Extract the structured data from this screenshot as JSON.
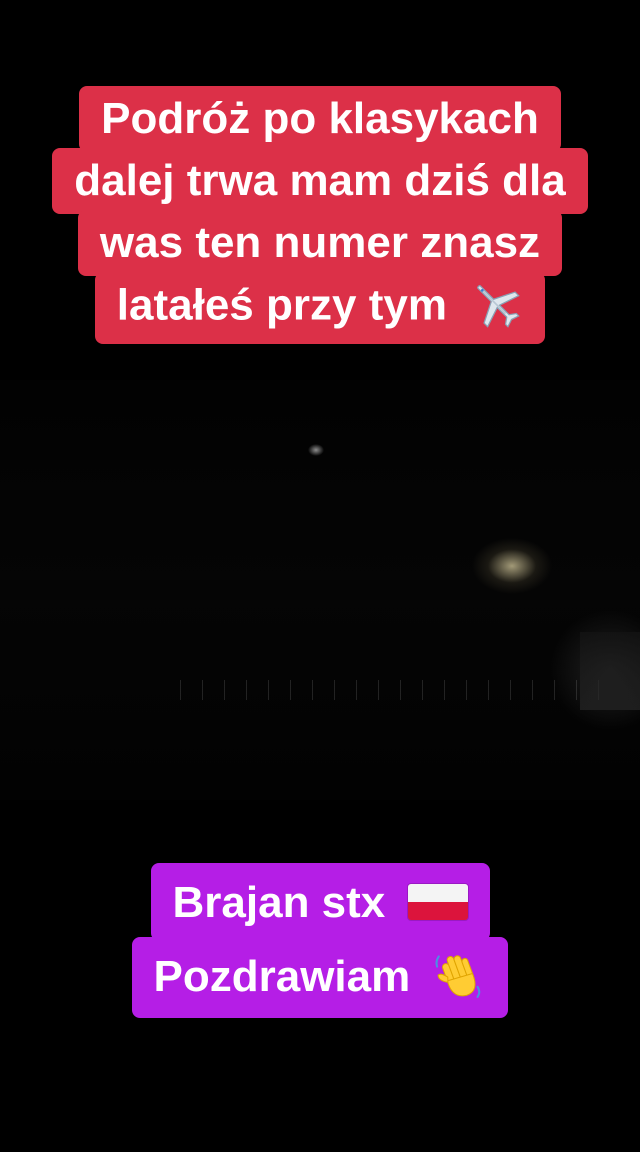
{
  "top_caption": {
    "lines": [
      "Podróż po klasykach",
      "dalej trwa mam dziś dla",
      "was ten numer znasz",
      "latałeś przy tym"
    ],
    "end_icon": "airplane-icon",
    "background_color": "#dc3048"
  },
  "bottom_caption": {
    "lines": [
      "Brajan stx",
      "Pozdrawiam"
    ],
    "line_icons": [
      "poland-flag-icon",
      "waving-hand-icon"
    ],
    "background_color": "#b51ee6"
  },
  "colors": {
    "background": "#000000",
    "text": "#ffffff"
  }
}
